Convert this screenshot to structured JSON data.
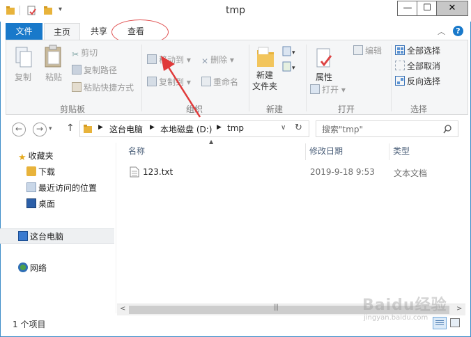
{
  "window": {
    "title": "tmp",
    "minimize": "—",
    "maximize": "☐",
    "close": "✕"
  },
  "ribbon_tabs": {
    "file": "文件",
    "home": "主页",
    "share": "共享",
    "view": "查看"
  },
  "clipboard": {
    "copy": "复制",
    "paste": "粘贴",
    "cut": "剪切",
    "copy_path": "复制路径",
    "paste_shortcut": "粘贴快捷方式",
    "group": "剪贴板"
  },
  "organize": {
    "move_to": "移动到",
    "copy_to": "复制到",
    "delete": "删除",
    "rename": "重命名",
    "group": "组织"
  },
  "new": {
    "new_folder_line1": "新建",
    "new_folder_line2": "文件夹",
    "group": "新建"
  },
  "open": {
    "properties": "属性",
    "open": "打开",
    "edit": "编辑",
    "group": "打开"
  },
  "select": {
    "select_all": "全部选择",
    "select_none": "全部取消",
    "invert": "反向选择",
    "group": "选择"
  },
  "address": {
    "back": "←",
    "forward": "→",
    "up": "↑",
    "crumbs": [
      "这台电脑",
      "本地磁盘 (D:)",
      "tmp"
    ],
    "refresh": "↻",
    "search_placeholder": "搜索\"tmp\""
  },
  "nav_pane": {
    "favorites": "收藏夹",
    "downloads": "下载",
    "recent": "最近访问的位置",
    "desktop": "桌面",
    "this_pc": "这台电脑",
    "network": "网络"
  },
  "columns": {
    "name": "名称",
    "date": "修改日期",
    "type": "类型"
  },
  "files": [
    {
      "name": "123.txt",
      "date": "2019-9-18 9:53",
      "type": "文本文档"
    }
  ],
  "status": {
    "count": "1 个项目"
  },
  "watermark": {
    "brand": "Baidu经验",
    "url": "jingyan.baidu.com"
  },
  "colors": {
    "accent": "#1979ca",
    "annotation": "#e05050"
  }
}
